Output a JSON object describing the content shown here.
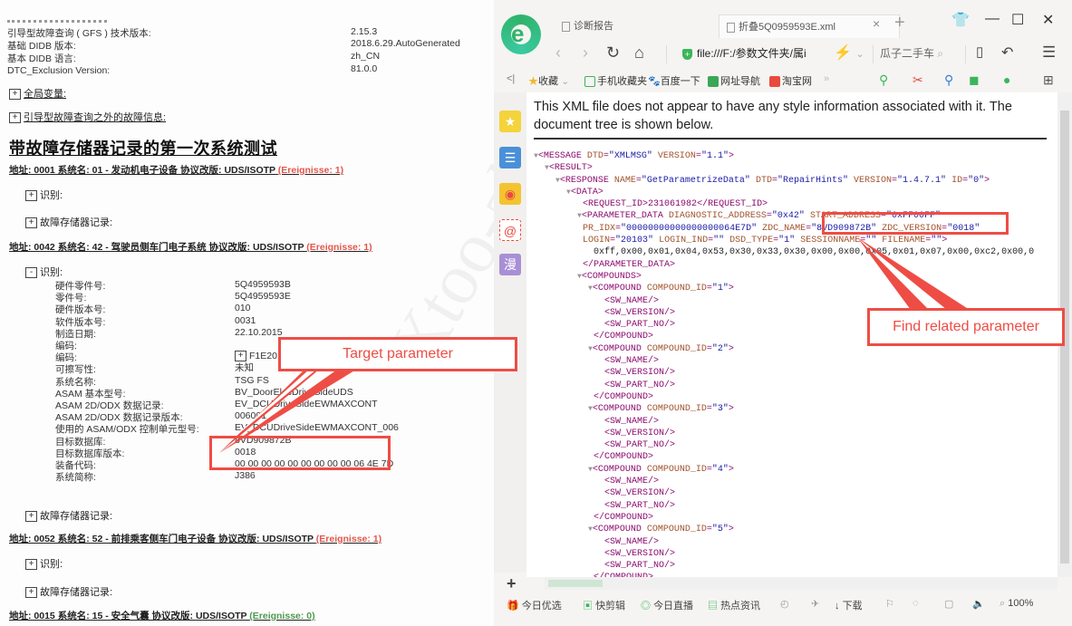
{
  "report": {
    "header_rows": [
      {
        "label": "引导型故障查询 ( GFS ) 技术版本:",
        "value": "2.15.3"
      },
      {
        "label": "基础 DIDB 版本:",
        "value": "2018.6.29.AutoGenerated"
      },
      {
        "label": "基本 DIDB 语言:",
        "value": "zh_CN"
      },
      {
        "label": "DTC_Exclusion Version:",
        "value": "81.0.0"
      }
    ],
    "global_vars": "全局变量:",
    "non_gfs_faults": "引导型故障查询之外的故障信息:",
    "title": "带故障存储器记录的第一次系统测试",
    "expand_plus": "+",
    "collapse_minus": "-",
    "systems": [
      {
        "line": "地址: 0001 系统名: 01 - 发动机电子设备 协议改版: UDS/ISOTP ",
        "events": "(Ereignisse: 1)",
        "ident": "识别:",
        "fault_mem": "故障存储器记录:"
      },
      {
        "line": "地址: 0042 系统名: 42 - 驾驶员侧车门电子系统 协议改版: UDS/ISOTP ",
        "events": "(Ereignisse: 1)",
        "ident": "识别:",
        "fault_mem": "故障存储器记录:"
      },
      {
        "line": "地址: 0052 系统名: 52 - 前排乘客侧车门电子设备 协议改版: UDS/ISOTP ",
        "events": "(Ereignisse: 1)",
        "ident": "识别:",
        "fault_mem": "故障存储器记录:"
      },
      {
        "line": "地址: 0015 系统名: 15 - 安全气囊 协议改版: UDS/ISOTP ",
        "events": "(Ereignisse: 0)"
      }
    ],
    "identification": [
      {
        "label": "硬件零件号:",
        "value": "5Q4959593B"
      },
      {
        "label": "零件号:",
        "value": "5Q4959593E"
      },
      {
        "label": "硬件版本号:",
        "value": "010"
      },
      {
        "label": "软件版本号:",
        "value": "0031"
      },
      {
        "label": "制造日期:",
        "value": "22.10.2015"
      },
      {
        "label": "编码:",
        "value": ""
      },
      {
        "label": "编码:",
        "value": "F1E20"
      },
      {
        "label": "可擦写性:",
        "value": "未知"
      },
      {
        "label": "系统名称:",
        "value": "TSG FS"
      },
      {
        "label": "ASAM 基本型号:",
        "value": "BV_DoorElecDriveSideUDS"
      },
      {
        "label": "ASAM 2D/ODX 数据记录:",
        "value": "EV_DCUDriveSideEWMAXCONT"
      },
      {
        "label": "ASAM 2D/ODX 数据记录版本:",
        "value": "006001"
      },
      {
        "label": "使用的 ASAM/ODX 控制单元型号:",
        "value": "EV_DCUDriveSideEWMAXCONT_006"
      },
      {
        "label": "目标数据库:",
        "value": "8VD909872B"
      },
      {
        "label": "目标数据库版本:",
        "value": "0018"
      },
      {
        "label": "装备代码:",
        "value": "00 00 00 00 00 00 00 00 00 06 4E 7D"
      },
      {
        "label": "系统简称:",
        "value": "J386"
      }
    ]
  },
  "annotations": {
    "target_parameter": "Target parameter",
    "find_related": "Find related parameter",
    "accent_color": "#ee4d45"
  },
  "watermark": "Xtoo-zhi",
  "browser": {
    "tabs": [
      {
        "label": "诊断报告",
        "active": false
      },
      {
        "label": "折叠5Q0959593E.xml",
        "active": true
      }
    ],
    "close_tab": "×",
    "new_tab": "+",
    "window_controls": {
      "skin": "👕",
      "minimize": "—",
      "maximize": "☐",
      "close": "✕"
    },
    "nav": {
      "back": "‹",
      "forward": "›",
      "reload": "↻",
      "home": "⌂"
    },
    "url": "file:///F:/参数文件夹/属i",
    "search_text": "瓜子二手车",
    "bookmarks": [
      "收藏",
      "手机收藏夹",
      "百度一下",
      "网址导航",
      "淘宝网"
    ],
    "bookmarks_more": "»",
    "sidebar_collapse": "<|",
    "xml_notice": "This XML file does not appear to have any style information associated with it. The document tree is shown below.",
    "xml_lines": [
      {
        "indent": 0,
        "tw": "▼",
        "html": "<MESSAGE DTD=\"XMLMSG\" VERSION=\"1.1\">"
      },
      {
        "indent": 1,
        "tw": "▼",
        "html": "<RESULT>"
      },
      {
        "indent": 2,
        "tw": "▼",
        "html": "<RESPONSE NAME=\"GetParametrizeData\" DTD=\"RepairHints\" VERSION=\"1.4.7.1\" ID=\"0\">"
      },
      {
        "indent": 3,
        "tw": "▼",
        "html": "<DATA>"
      },
      {
        "indent": 4,
        "tw": "",
        "html": "<REQUEST_ID>231061982</REQUEST_ID>"
      },
      {
        "indent": 4,
        "tw": "▼",
        "html": "<PARAMETER_DATA DIAGNOSTIC_ADDRESS=\"0x42\" START_ADDRESS=\"0xFF00FF\""
      },
      {
        "indent": 4,
        "tw": "",
        "html": "PR_IDX=\"00000000000000000064E7D\" ZDC_NAME=\"8VD909872B\" ZDC_VERSION=\"0018\""
      },
      {
        "indent": 4,
        "tw": "",
        "html": "LOGIN=\"20103\" LOGIN_IND=\"\" DSD_TYPE=\"1\" SESSIONNAME=\"\" FILENAME=\"\">"
      },
      {
        "indent": 5,
        "tw": "",
        "html": "0xff,0x00,0x01,0x04,0x53,0x30,0x33,0x30,0x00,0x00,0x05,0x01,0x07,0x00,0xc2,0x00,0"
      },
      {
        "indent": 4,
        "tw": "",
        "html": "</PARAMETER_DATA>"
      },
      {
        "indent": 4,
        "tw": "▼",
        "html": "<COMPOUNDS>"
      },
      {
        "indent": 5,
        "tw": "▼",
        "html": "<COMPOUND COMPOUND_ID=\"1\">"
      },
      {
        "indent": 6,
        "tw": "",
        "html": "<SW_NAME/>"
      },
      {
        "indent": 6,
        "tw": "",
        "html": "<SW_VERSION/>"
      },
      {
        "indent": 6,
        "tw": "",
        "html": "<SW_PART_NO/>"
      },
      {
        "indent": 5,
        "tw": "",
        "html": "</COMPOUND>"
      },
      {
        "indent": 5,
        "tw": "▼",
        "html": "<COMPOUND COMPOUND_ID=\"2\">"
      },
      {
        "indent": 6,
        "tw": "",
        "html": "<SW_NAME/>"
      },
      {
        "indent": 6,
        "tw": "",
        "html": "<SW_VERSION/>"
      },
      {
        "indent": 6,
        "tw": "",
        "html": "<SW_PART_NO/>"
      },
      {
        "indent": 5,
        "tw": "",
        "html": "</COMPOUND>"
      },
      {
        "indent": 5,
        "tw": "▼",
        "html": "<COMPOUND COMPOUND_ID=\"3\">"
      },
      {
        "indent": 6,
        "tw": "",
        "html": "<SW_NAME/>"
      },
      {
        "indent": 6,
        "tw": "",
        "html": "<SW_VERSION/>"
      },
      {
        "indent": 6,
        "tw": "",
        "html": "<SW_PART_NO/>"
      },
      {
        "indent": 5,
        "tw": "",
        "html": "</COMPOUND>"
      },
      {
        "indent": 5,
        "tw": "▼",
        "html": "<COMPOUND COMPOUND_ID=\"4\">"
      },
      {
        "indent": 6,
        "tw": "",
        "html": "<SW_NAME/>"
      },
      {
        "indent": 6,
        "tw": "",
        "html": "<SW_VERSION/>"
      },
      {
        "indent": 6,
        "tw": "",
        "html": "<SW_PART_NO/>"
      },
      {
        "indent": 5,
        "tw": "",
        "html": "</COMPOUND>"
      },
      {
        "indent": 5,
        "tw": "▼",
        "html": "<COMPOUND COMPOUND_ID=\"5\">"
      },
      {
        "indent": 6,
        "tw": "",
        "html": "<SW_NAME/>"
      },
      {
        "indent": 6,
        "tw": "",
        "html": "<SW_VERSION/>"
      },
      {
        "indent": 6,
        "tw": "",
        "html": "<SW_PART_NO/>"
      },
      {
        "indent": 5,
        "tw": "",
        "html": "</COMPOUND>"
      }
    ],
    "statusbar": {
      "today_picks": "今日优选",
      "kuaijian": "快剪辑",
      "today_live": "今日直播",
      "hot_news": "热点资讯",
      "download": "下载",
      "zoom": "100%"
    },
    "colors": {
      "logo_green": "#2fb36b",
      "tag": "#8b0a6e",
      "attr": "#a0522d",
      "value": "#1a1aa6"
    }
  }
}
